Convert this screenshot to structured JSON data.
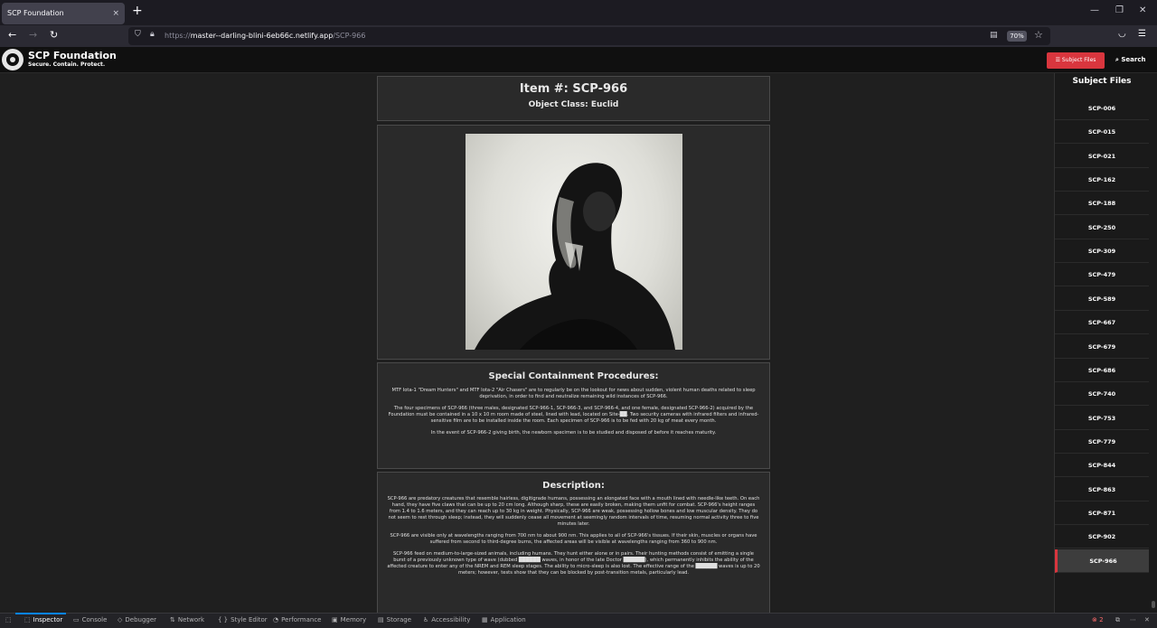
{
  "browser": {
    "tab_title": "SCP Foundation",
    "tab_close": "×",
    "new_tab": "+",
    "url_prefix": "https://",
    "url_host": "master--darling-blini-6eb66c.netlify.app",
    "url_path": "/SCP-966",
    "zoom": "70%",
    "window_controls": {
      "minimize": "—",
      "restore": "❐",
      "close": "✕"
    }
  },
  "header": {
    "site_title": "SCP Foundation",
    "tagline": "Secure. Contain. Protect.",
    "subject_files_button": "Subject Files",
    "search_label": "Search"
  },
  "article": {
    "item_title": "Item #: SCP-966",
    "object_class": "Object Class: Euclid",
    "containment_heading": "Special Containment Procedures:",
    "containment_paragraphs": [
      "MTF Iota-1 \"Dream Hunters\" and MTF Iota-2 \"Air Chasers\" are to regularly be on the lookout for news about sudden, violent human deaths related to sleep deprivation, in order to find and neutralize remaining wild instances of SCP-966.",
      "The four specimens of SCP-966 (three males, designated SCP-966-1, SCP-966-3, and SCP-966-4, and one female, designated SCP-966-2) acquired by the Foundation must be contained in a 10 x 10 m room made of steel, lined with lead, located on Site-██. Two security cameras with infrared filters and infrared-sensitive film are to be installed inside the room. Each specimen of SCP-966 is to be fed with 20 kg of meat every month.",
      "In the event of SCP-966-2 giving birth, the newborn specimen is to be studied and disposed of before it reaches maturity."
    ],
    "description_heading": "Description:",
    "description_paragraphs": [
      "SCP-966 are predatory creatures that resemble hairless, digitigrade humans, possessing an elongated face with a mouth lined with needle-like teeth. On each hand, they have five claws that can be up to 20 cm long. Although sharp, these are easily broken, making them unfit for combat. SCP-966's height ranges from 1.4 to 1.6 meters, and they can reach up to 30 kg in weight. Physically, SCP-966 are weak, possessing hollow bones and low muscular density. They do not seem to rest through sleep; instead, they will suddenly cease all movement at seemingly random intervals of time, resuming normal activity three to five minutes later.",
      "SCP-966 are visible only at wavelengths ranging from 700 nm to about 900 nm. This applies to all of SCP-966's tissues. If their skin, muscles or organs have suffered from second to third-degree burns, the affected areas will be visible at wavelengths ranging from 360 to 900 nm.",
      "SCP-966 feed on medium-to-large-sized animals, including humans. They hunt either alone or in pairs. Their hunting methods consist of emitting a single burst of a previously unknown type of wave (dubbed ██████ waves, in honor of the late Doctor ██████), which permanently inhibits the ability of the affected creature to enter any of the NREM and REM sleep stages. The ability to micro-sleep is also lost. The effective range of the ██████ waves is up to 20 meters; however, tests show that they can be blocked by post-transition metals, particularly lead."
    ]
  },
  "sidebar": {
    "heading": "Subject Files",
    "items": [
      "SCP-006",
      "SCP-015",
      "SCP-021",
      "SCP-162",
      "SCP-188",
      "SCP-250",
      "SCP-309",
      "SCP-479",
      "SCP-589",
      "SCP-667",
      "SCP-679",
      "SCP-686",
      "SCP-740",
      "SCP-753",
      "SCP-779",
      "SCP-844",
      "SCP-863",
      "SCP-871",
      "SCP-902",
      "SCP-966"
    ],
    "active_item": "SCP-966"
  },
  "devtools": {
    "tabs": [
      "Inspector",
      "Console",
      "Debugger",
      "Network",
      "Style Editor",
      "Performance",
      "Memory",
      "Storage",
      "Accessibility",
      "Application"
    ],
    "icons": [
      "inspector-icon",
      "console-icon",
      "debugger-icon",
      "network-icon",
      "style-editor-icon",
      "performance-icon",
      "memory-icon",
      "storage-icon",
      "accessibility-icon",
      "application-icon"
    ],
    "active_tab": "Inspector",
    "error_count": "2"
  },
  "colors": {
    "accent": "#d9363e",
    "page_bg": "#1f1f1f",
    "card_bg": "#2a2a2a"
  }
}
